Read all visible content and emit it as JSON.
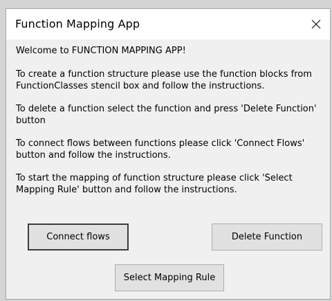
{
  "window": {
    "title": "Function Mapping App",
    "close_icon": "close-icon"
  },
  "content": {
    "paragraphs": [
      "Welcome to FUNCTION MAPPING APP!",
      "To create a function structure please use the function blocks from FunctionClasses stencil box and follow the instructions.",
      "To delete a function select the function and press 'Delete Function' button",
      "To connect flows between functions please click 'Connect Flows' button and follow the instructions.",
      "To start the mapping of function structure please click 'Select Mapping Rule' button and follow the instructions."
    ]
  },
  "buttons": {
    "connect_flows": "Connect flows",
    "delete_function": "Delete Function",
    "select_mapping_rule": "Select Mapping Rule"
  }
}
